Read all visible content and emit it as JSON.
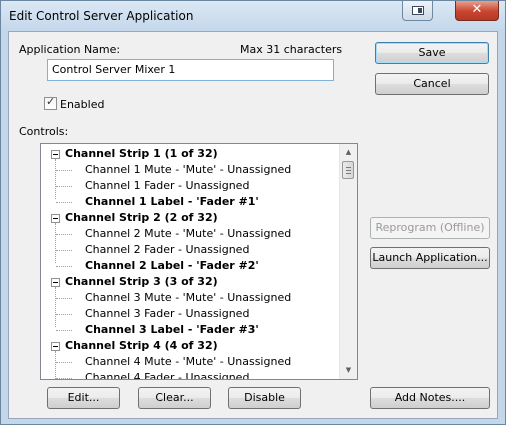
{
  "window": {
    "title": "Edit Control Server Application"
  },
  "form": {
    "app_name_label": "Application Name:",
    "max_chars_label": "Max 31 characters",
    "app_name_value": "Control Server Mixer 1",
    "enabled_label": "Enabled",
    "enabled_checked": true,
    "controls_label": "Controls:"
  },
  "tree": {
    "strips": [
      {
        "label": "Channel Strip 1 (1 of 32)",
        "items": [
          "Channel 1 Mute - 'Mute' - Unassigned",
          "Channel 1 Fader - Unassigned",
          "Channel 1 Label - 'Fader #1'"
        ]
      },
      {
        "label": "Channel Strip 2 (2 of 32)",
        "items": [
          "Channel 2 Mute - 'Mute' - Unassigned",
          "Channel 2 Fader - Unassigned",
          "Channel 2 Label - 'Fader #2'"
        ]
      },
      {
        "label": "Channel Strip 3 (3 of 32)",
        "items": [
          "Channel 3 Mute - 'Mute' - Unassigned",
          "Channel 3 Fader - Unassigned",
          "Channel 3 Label - 'Fader #3'"
        ]
      },
      {
        "label": "Channel Strip 4 (4 of 32)",
        "items": [
          "Channel 4 Mute - 'Mute' - Unassigned",
          "Channel 4 Fader - Unassigned"
        ]
      }
    ]
  },
  "buttons": {
    "save": "Save",
    "cancel": "Cancel",
    "reprogram": "Reprogram (Offline)",
    "launch": "Launch Application...",
    "edit": "Edit...",
    "clear": "Clear...",
    "disable": "Disable",
    "add_notes": "Add Notes...."
  }
}
